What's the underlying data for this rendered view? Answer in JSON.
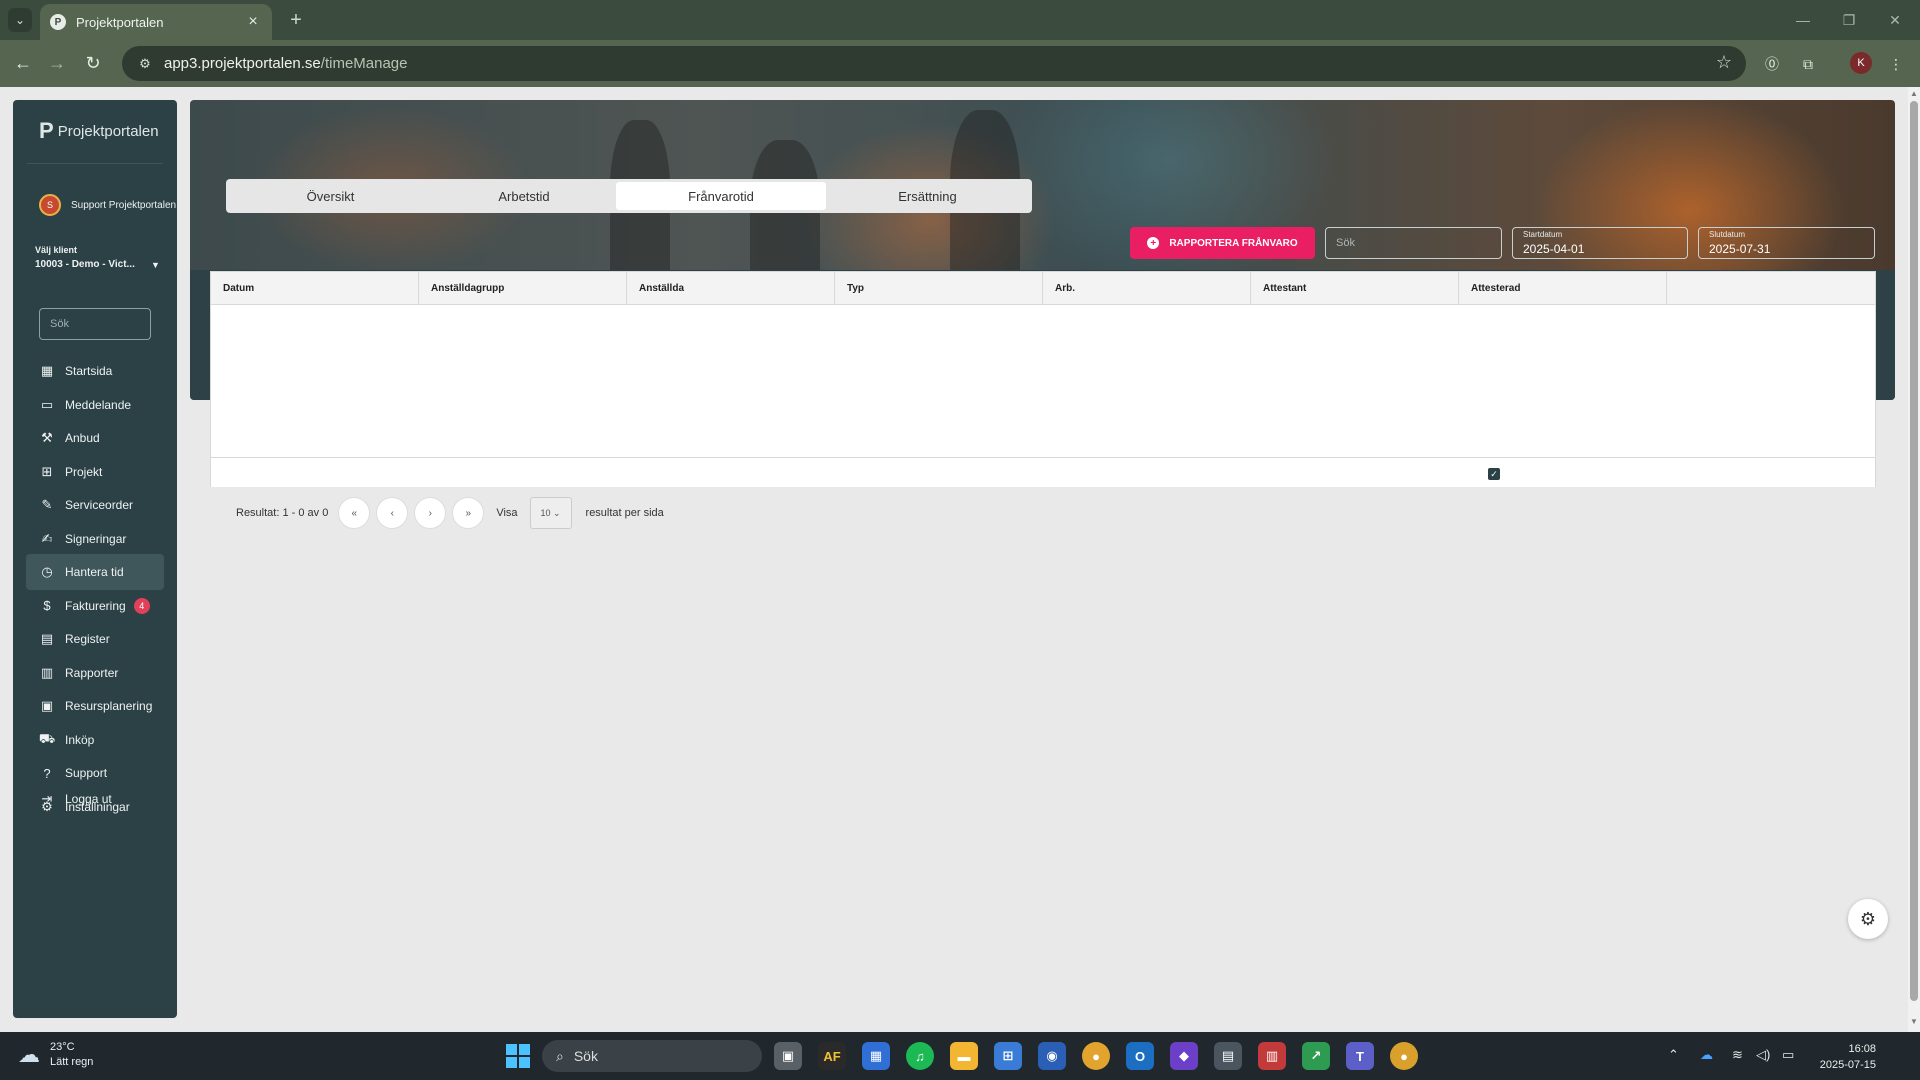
{
  "browser": {
    "tab_title": "Projektportalen",
    "url_host": "app3.projektportalen.se",
    "url_path": "/timeManage",
    "profile_initial": "K"
  },
  "sidebar": {
    "logo_text": "Projektportalen",
    "user_name": "Support Projektportalen",
    "client_label": "Välj klient",
    "client_value": "10003 - Demo - Vict...",
    "search_placeholder": "Sök",
    "items": [
      {
        "label": "Startsida",
        "icon": "dashboard-icon"
      },
      {
        "label": "Meddelande",
        "icon": "message-icon"
      },
      {
        "label": "Anbud",
        "icon": "gavel-icon"
      },
      {
        "label": "Projekt",
        "icon": "grid-icon"
      },
      {
        "label": "Serviceorder",
        "icon": "wrench-icon"
      },
      {
        "label": "Signeringar",
        "icon": "signature-icon"
      },
      {
        "label": "Hantera tid",
        "icon": "clock-icon"
      },
      {
        "label": "Fakturering",
        "icon": "dollar-icon",
        "badge": "4"
      },
      {
        "label": "Register",
        "icon": "register-icon"
      },
      {
        "label": "Rapporter",
        "icon": "report-icon"
      },
      {
        "label": "Resursplanering",
        "icon": "calendar-icon"
      },
      {
        "label": "Inköp",
        "icon": "cart-icon"
      },
      {
        "label": "Support",
        "icon": "help-icon"
      },
      {
        "label": "Inställningar",
        "icon": "gear-icon"
      }
    ],
    "logout_label": "Logga ut"
  },
  "tabs": [
    {
      "label": "Översikt"
    },
    {
      "label": "Arbetstid"
    },
    {
      "label": "Frånvarotid"
    },
    {
      "label": "Ersättning"
    }
  ],
  "actions": {
    "report_label": "RAPPORTERA FRÅNVARO",
    "search_placeholder": "Sök",
    "start_label": "Startdatum",
    "start_value": "2025-04-01",
    "end_label": "Slutdatum",
    "end_value": "2025-07-31"
  },
  "table": {
    "columns": [
      "Datum",
      "Anställdagrupp",
      "Anställda",
      "Typ",
      "Arb.",
      "Attestant",
      "Attesterad",
      ""
    ]
  },
  "pager": {
    "result_text": "Resultat: 1 - 0 av 0",
    "first": "«",
    "prev": "‹",
    "next": "›",
    "last": "»",
    "show_label": "Visa",
    "per_page": "10",
    "per_page_label": "resultat per sida"
  },
  "taskbar": {
    "temperature": "23°C",
    "weather": "Lätt regn",
    "search_label": "Sök",
    "time": "16:08",
    "date": "2025-07-15"
  }
}
